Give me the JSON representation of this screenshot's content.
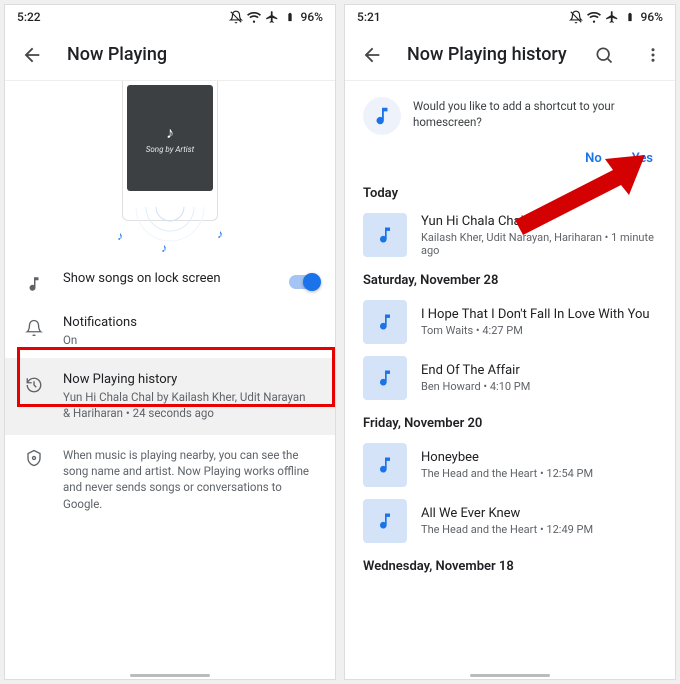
{
  "left": {
    "status": {
      "time": "5:22",
      "battery": "96%"
    },
    "title": "Now Playing",
    "preview_label": "Song by Artist",
    "settings": {
      "lock_screen": {
        "label": "Show songs on lock screen"
      },
      "notifications": {
        "label": "Notifications",
        "sub": "On"
      },
      "history": {
        "label": "Now Playing history",
        "sub": "Yun Hi Chala Chal by Kailash Kher, Udit Narayan & Hariharan • 24 seconds ago"
      },
      "privacy": {
        "sub": "When music is playing nearby, you can see the song name and artist. Now Playing works offline and never sends songs or conversations to Google."
      }
    }
  },
  "right": {
    "status": {
      "time": "5:21",
      "battery": "96%"
    },
    "title": "Now Playing history",
    "prompt": {
      "text": "Would you like to add a shortcut to your homescreen?",
      "no": "No",
      "yes": "Yes"
    },
    "sections": [
      {
        "label": "Today",
        "items": [
          {
            "song": "Yun Hi Chala Chal",
            "meta": "Kailash Kher, Udit Narayan, Hariharan • 1 minute ago"
          }
        ]
      },
      {
        "label": "Saturday, November 28",
        "items": [
          {
            "song": "I Hope That I Don't Fall In Love With You",
            "meta": "Tom Waits • 4:27 PM"
          },
          {
            "song": "End Of The Affair",
            "meta": "Ben Howard • 4:10 PM"
          }
        ]
      },
      {
        "label": "Friday, November 20",
        "items": [
          {
            "song": "Honeybee",
            "meta": "The Head and the Heart • 12:54 PM"
          },
          {
            "song": "All We Ever Knew",
            "meta": "The Head and the Heart • 12:49 PM"
          }
        ]
      },
      {
        "label": "Wednesday, November 18",
        "items": []
      }
    ]
  }
}
